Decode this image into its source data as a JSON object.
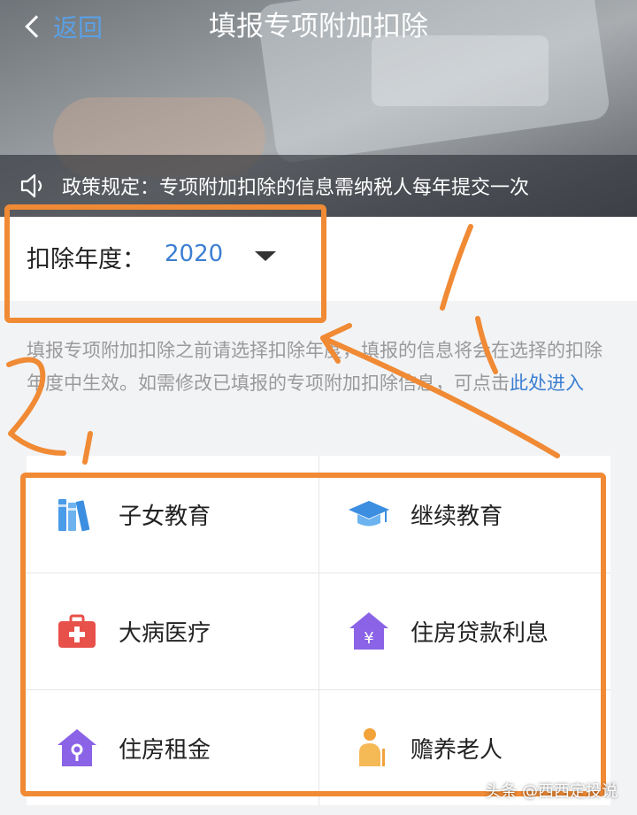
{
  "header": {
    "back_label": "返回",
    "title": "填报专项附加扣除"
  },
  "notice": {
    "icon": "speaker-icon",
    "text": "政策规定：专项附加扣除的信息需纳税人每年提交一次"
  },
  "year_selector": {
    "label": "扣除年度：",
    "value": "2020",
    "icon": "caret-down-icon"
  },
  "description": {
    "text": "填报专项附加扣除之前请选择扣除年度，填报的信息将会在选择的扣除年度中生效。如需修改已填报的专项附加扣除信息，可点击",
    "link_text": "此处进入"
  },
  "categories": [
    {
      "label": "子女教育",
      "icon": "books-icon",
      "color": "#4a9be8"
    },
    {
      "label": "继续教育",
      "icon": "graduation-cap-icon",
      "color": "#3b8ee0"
    },
    {
      "label": "大病医疗",
      "icon": "medical-kit-icon",
      "color": "#e8504a"
    },
    {
      "label": "住房贷款利息",
      "icon": "house-yuan-icon",
      "color": "#8a63e6"
    },
    {
      "label": "住房租金",
      "icon": "house-key-icon",
      "color": "#8a63e6"
    },
    {
      "label": "赡养老人",
      "icon": "elderly-person-icon",
      "color": "#f2a33a"
    }
  ],
  "annotations": {
    "color": "#f08a34",
    "marks": [
      "1",
      "2"
    ]
  },
  "watermark": "头条 @西西定投说"
}
